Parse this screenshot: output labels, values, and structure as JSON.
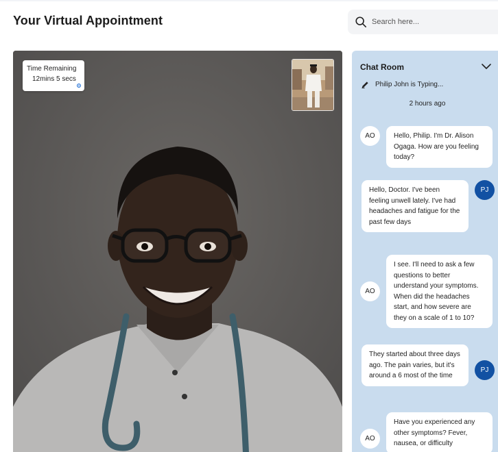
{
  "page": {
    "title": "Your Virtual Appointment"
  },
  "search": {
    "placeholder": "Search here..."
  },
  "video": {
    "timer_label": "Time Remaining",
    "timer_value": "12mins 5 secs"
  },
  "chat": {
    "title": "Chat Room",
    "typing": "Philip John is Typing...",
    "timestamp": "2 hours ago",
    "messages": [
      {
        "from": "doctor",
        "initials": "AO",
        "text": "Hello, Philip. I'm Dr. Alison Ogaga. How are you feeling today?"
      },
      {
        "from": "patient",
        "initials": "PJ",
        "text": "Hello, Doctor. I've been feeling unwell lately. I've had headaches and fatigue for the past few days"
      },
      {
        "from": "doctor",
        "initials": "AO",
        "text": "I see. I'll need to ask a few questions to better understand your symptoms. When did the headaches start, and how severe are they on a scale of 1 to 10?"
      },
      {
        "from": "patient",
        "initials": "PJ",
        "text": "They started about three days ago. The pain varies, but it's around a 6 most of the time"
      },
      {
        "from": "doctor",
        "initials": "AO",
        "text": "Have you experienced any other symptoms? Fever, nausea, or difficulty"
      }
    ]
  },
  "colors": {
    "chat_bg": "#c9dcee",
    "patient_avatar": "#1251a3",
    "video_bg": "#5f5c5a"
  },
  "icons": {
    "search": "search-icon",
    "chevron": "chevron-down-icon",
    "typing": "pencil-icon",
    "timer": "gear-icon"
  }
}
